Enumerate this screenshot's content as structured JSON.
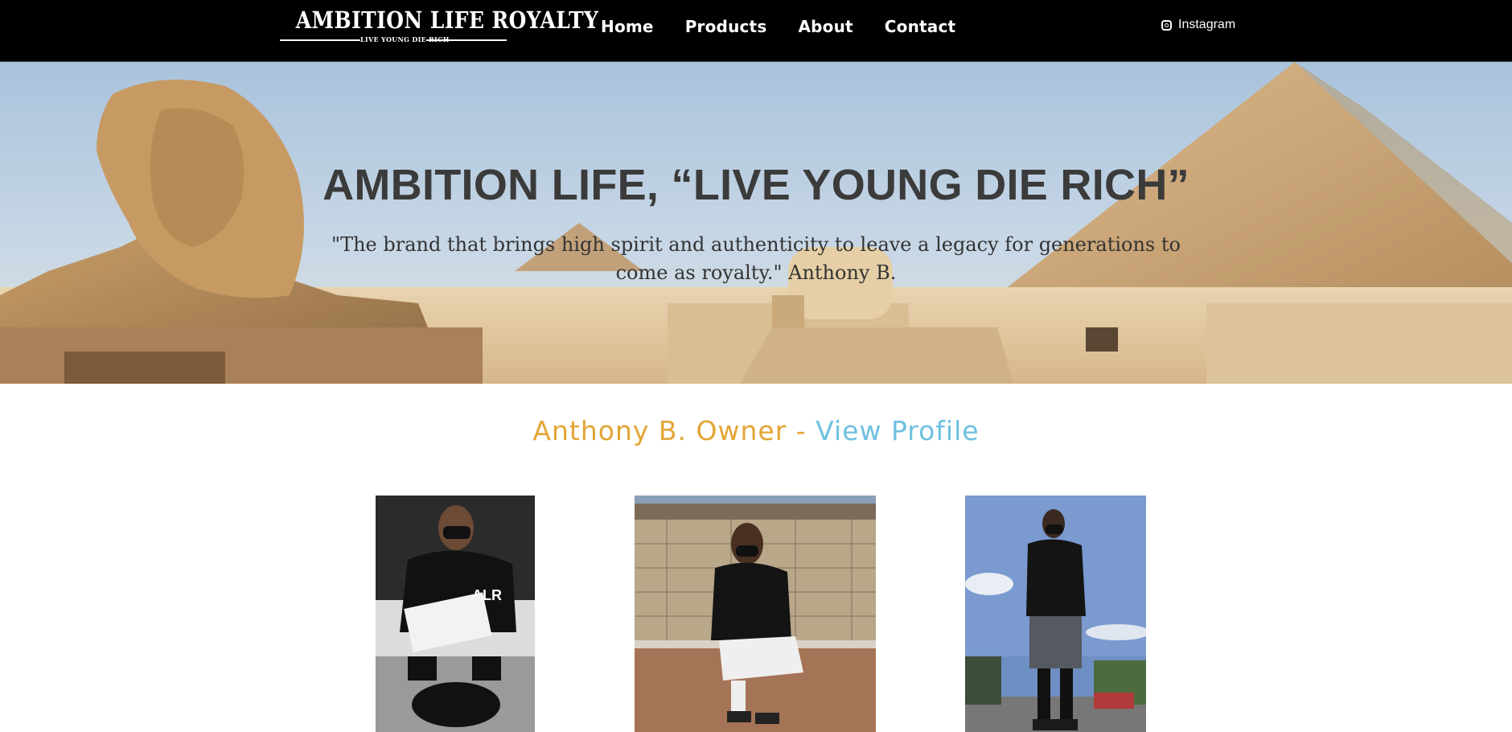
{
  "header": {
    "logo_title": "AMBITION LIFE ROYALTY",
    "logo_tagline": "LIVE YOUNG DIE RICH",
    "nav": [
      "Home",
      "Products",
      "About",
      "Contact"
    ],
    "social": {
      "label": "Instagram",
      "icon": "instagram-icon"
    }
  },
  "hero": {
    "title": "AMBITION LIFE, “LIVE YOUNG DIE RICH”",
    "quote": "\"The brand that brings high spirit and authenticity to leave a legacy for generations to come as royalty.\" Anthony B."
  },
  "owner": {
    "name": "Anthony B. Owner - ",
    "link": "View Profile"
  },
  "photos": [
    {
      "name": "photo-crouching-with-bag"
    },
    {
      "name": "photo-sitting-on-railing"
    },
    {
      "name": "photo-standing-outdoors"
    }
  ],
  "colors": {
    "header_bg": "#000000",
    "owner_name": "#e3a535",
    "profile_link": "#6ec0e0",
    "hero_title": "#3b3b3b"
  }
}
